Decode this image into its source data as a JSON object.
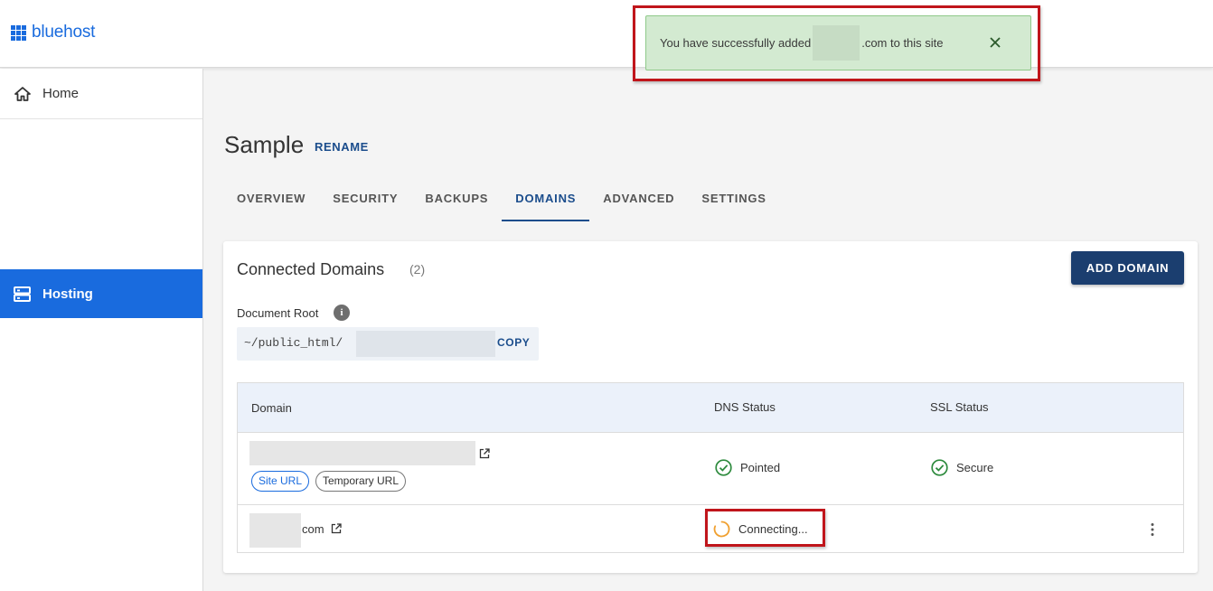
{
  "brand": {
    "name": "bluehost",
    "color": "#196bde"
  },
  "sidebar": {
    "items": [
      {
        "label": "Home",
        "icon": "home-icon",
        "active": false
      },
      {
        "label": "Hosting",
        "icon": "server-icon",
        "active": true
      }
    ]
  },
  "toast": {
    "text_before": "You have successfully added",
    "text_after": ".com to this site",
    "close_icon": "close-icon"
  },
  "site": {
    "title": "Sample",
    "rename_label": "RENAME"
  },
  "tabs": [
    {
      "label": "OVERVIEW",
      "active": false
    },
    {
      "label": "SECURITY",
      "active": false
    },
    {
      "label": "BACKUPS",
      "active": false
    },
    {
      "label": "DOMAINS",
      "active": true
    },
    {
      "label": "ADVANCED",
      "active": false
    },
    {
      "label": "SETTINGS",
      "active": false
    }
  ],
  "domains_card": {
    "title": "Connected Domains",
    "count": "(2)",
    "add_button": "ADD DOMAIN",
    "document_root_label": "Document Root",
    "document_root_path": "~/public_html/",
    "copy_label": "COPY",
    "table": {
      "headers": {
        "domain": "Domain",
        "dns": "DNS Status",
        "ssl": "SSL Status"
      },
      "rows": [
        {
          "domain": "",
          "tags": [
            "Site URL",
            "Temporary URL"
          ],
          "dns_status": "Pointed",
          "ssl_status": "Secure"
        },
        {
          "domain": "com",
          "dns_status": "Connecting...",
          "ssl_status": ""
        }
      ]
    }
  },
  "colors": {
    "accent": "#1b4d8c",
    "success": "#2e8b3e",
    "pending": "#f0a030",
    "highlight": "#c0151b"
  }
}
